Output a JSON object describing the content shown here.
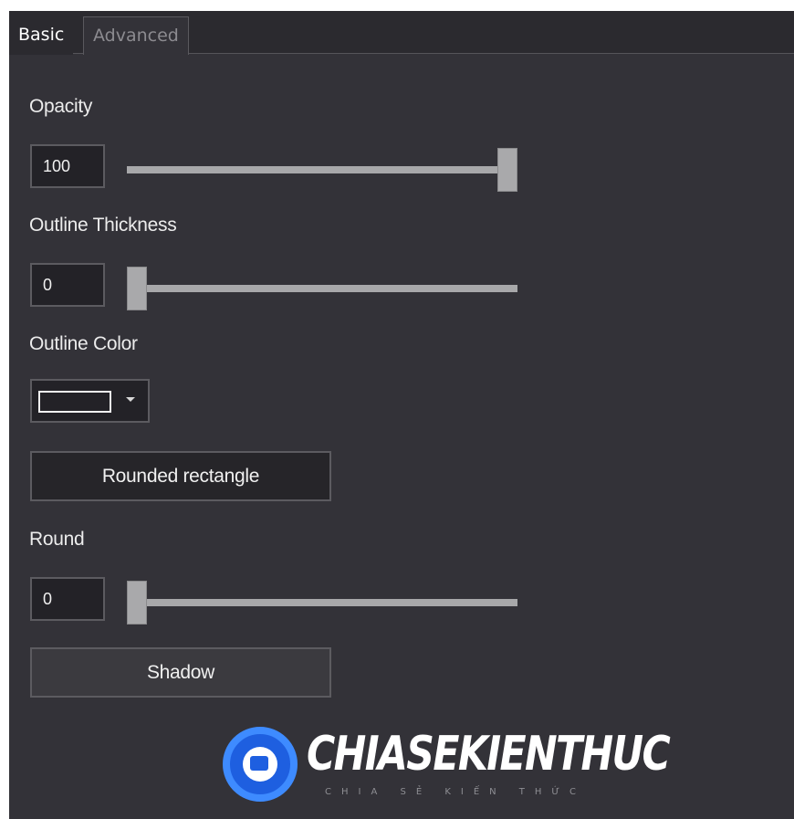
{
  "tabs": [
    {
      "label": "Basic",
      "active": true
    },
    {
      "label": "Advanced",
      "active": false
    }
  ],
  "opacity": {
    "label": "Opacity",
    "value": "100",
    "slider_fraction": 1.0
  },
  "outline_thickness": {
    "label": "Outline Thickness",
    "value": "0",
    "slider_fraction": 0.0
  },
  "outline_color": {
    "label": "Outline Color",
    "swatch_color": "#232227"
  },
  "rounded_rectangle_button": {
    "label": "Rounded rectangle"
  },
  "round": {
    "label": "Round",
    "value": "0",
    "slider_fraction": 0.0
  },
  "shadow_button": {
    "label": "Shadow"
  },
  "watermark": {
    "text": "CHIASEKIENTHUC",
    "subtext": "CHIA SẺ KIẾN THỨC"
  },
  "colors": {
    "panel_bg": "#333238",
    "input_bg": "#232227",
    "slider": "#a8a8aa",
    "logo_blue": "#1e5fe0"
  }
}
